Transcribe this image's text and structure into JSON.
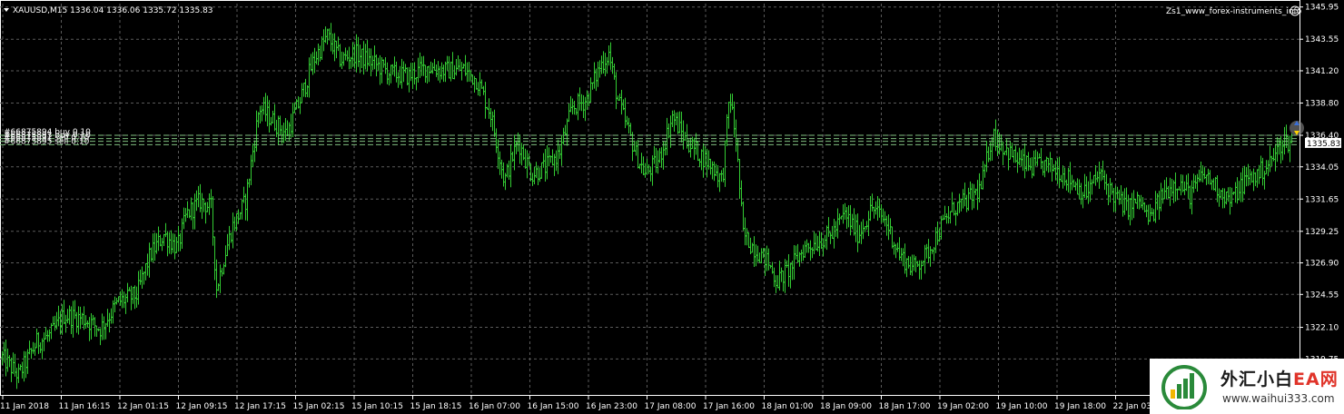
{
  "header": {
    "symbol_line": "XAUUSD,M15  1336.04 1336.06 1335.72 1335.83",
    "indicator_label": "Zs1_www_forex-instruments_info"
  },
  "colors": {
    "background": "#000000",
    "grid": "#5a5a5a",
    "bars": "#33cc33",
    "order_lines": "#7fbf7f",
    "price_tag_bg": "#ffffff",
    "axis_text": "#ffffff"
  },
  "chart_data": {
    "type": "ohlc",
    "symbol": "XAUUSD",
    "timeframe": "M15",
    "current_price": "1335.83",
    "ohlc_last": {
      "open": 1336.04,
      "high": 1336.06,
      "low": 1335.72,
      "close": 1335.83
    },
    "ylim": [
      1317.0,
      1346.2
    ],
    "y_ticks": [
      "1345.95",
      "1343.55",
      "1341.20",
      "1338.80",
      "1336.40",
      "1334.05",
      "1331.65",
      "1329.25",
      "1326.90",
      "1324.55",
      "1322.10",
      "1319.75"
    ],
    "x_ticks": [
      "11 Jan 2018",
      "11 Jan 16:15",
      "12 Jan 01:15",
      "12 Jan 09:15",
      "12 Jan 17:15",
      "15 Jan 02:15",
      "15 Jan 10:15",
      "15 Jan 18:15",
      "16 Jan 07:00",
      "16 Jan 15:00",
      "16 Jan 23:00",
      "17 Jan 08:00",
      "17 Jan 16:00",
      "18 Jan 01:00",
      "18 Jan 09:00",
      "18 Jan 17:00",
      "19 Jan 02:00",
      "19 Jan 10:00",
      "19 Jan 18:00",
      "22 Jan 03:00"
    ],
    "grid": true,
    "orders": [
      {
        "label": "#66875894 buy 0.10",
        "price": 1336.4
      },
      {
        "label": "#66875893 buy 0.10",
        "price": 1336.15
      },
      {
        "label": "#66875891 sell 0.10",
        "price": 1335.95
      },
      {
        "label": "#66875895 sell 0.10",
        "price": 1335.7
      }
    ],
    "close_path": [
      [
        0,
        1320.0
      ],
      [
        20,
        1318.5
      ],
      [
        40,
        1321.0
      ],
      [
        55,
        1321.5
      ],
      [
        70,
        1323.0
      ],
      [
        90,
        1322.8
      ],
      [
        110,
        1322.0
      ],
      [
        130,
        1324.0
      ],
      [
        150,
        1324.5
      ],
      [
        165,
        1327.5
      ],
      [
        180,
        1329.0
      ],
      [
        195,
        1328.0
      ],
      [
        205,
        1330.5
      ],
      [
        220,
        1331.5
      ],
      [
        232,
        1331.0
      ],
      [
        238,
        1325.0
      ],
      [
        245,
        1327.0
      ],
      [
        255,
        1329.5
      ],
      [
        270,
        1331.5
      ],
      [
        285,
        1338.5
      ],
      [
        300,
        1337.5
      ],
      [
        315,
        1336.5
      ],
      [
        330,
        1339.0
      ],
      [
        345,
        1342.0
      ],
      [
        360,
        1343.8
      ],
      [
        375,
        1342.0
      ],
      [
        390,
        1342.5
      ],
      [
        410,
        1341.8
      ],
      [
        430,
        1341.0
      ],
      [
        450,
        1340.8
      ],
      [
        470,
        1341.5
      ],
      [
        490,
        1341.2
      ],
      [
        510,
        1341.3
      ],
      [
        525,
        1340.5
      ],
      [
        540,
        1338.0
      ],
      [
        555,
        1333.0
      ],
      [
        570,
        1336.0
      ],
      [
        585,
        1333.5
      ],
      [
        600,
        1334.0
      ],
      [
        615,
        1335.0
      ],
      [
        630,
        1338.5
      ],
      [
        645,
        1339.0
      ],
      [
        660,
        1341.5
      ],
      [
        670,
        1342.5
      ],
      [
        680,
        1339.0
      ],
      [
        690,
        1337.0
      ],
      [
        700,
        1335.0
      ],
      [
        710,
        1333.5
      ],
      [
        725,
        1334.5
      ],
      [
        740,
        1337.8
      ],
      [
        755,
        1336.0
      ],
      [
        770,
        1335.0
      ],
      [
        785,
        1334.0
      ],
      [
        795,
        1333.0
      ],
      [
        803,
        1339.5
      ],
      [
        810,
        1336.0
      ],
      [
        818,
        1329.0
      ],
      [
        830,
        1328.0
      ],
      [
        845,
        1327.0
      ],
      [
        855,
        1325.5
      ],
      [
        870,
        1326.5
      ],
      [
        885,
        1328.0
      ],
      [
        900,
        1328.5
      ],
      [
        915,
        1329.0
      ],
      [
        930,
        1330.5
      ],
      [
        945,
        1329.0
      ],
      [
        960,
        1331.0
      ],
      [
        975,
        1330.0
      ],
      [
        990,
        1327.5
      ],
      [
        1005,
        1326.5
      ],
      [
        1020,
        1327.5
      ],
      [
        1035,
        1329.5
      ],
      [
        1050,
        1331.0
      ],
      [
        1065,
        1331.5
      ],
      [
        1080,
        1332.5
      ],
      [
        1092,
        1336.5
      ],
      [
        1105,
        1335.5
      ],
      [
        1120,
        1334.5
      ],
      [
        1135,
        1334.0
      ],
      [
        1150,
        1334.2
      ],
      [
        1165,
        1333.8
      ],
      [
        1180,
        1333.0
      ],
      [
        1195,
        1332.0
      ],
      [
        1210,
        1333.5
      ],
      [
        1225,
        1332.0
      ],
      [
        1240,
        1331.0
      ],
      [
        1255,
        1331.5
      ],
      [
        1265,
        1330.0
      ],
      [
        1280,
        1332.0
      ],
      [
        1295,
        1333.0
      ],
      [
        1310,
        1332.0
      ],
      [
        1325,
        1333.5
      ],
      [
        1340,
        1332.5
      ],
      [
        1355,
        1331.5
      ],
      [
        1370,
        1333.0
      ],
      [
        1385,
        1333.5
      ],
      [
        1400,
        1334.5
      ],
      [
        1412,
        1336.0
      ],
      [
        1422,
        1335.83
      ]
    ]
  },
  "watermark": {
    "brand_cn": "外汇小白",
    "brand_ea": "EA网",
    "url": "www.waihui333.com"
  }
}
